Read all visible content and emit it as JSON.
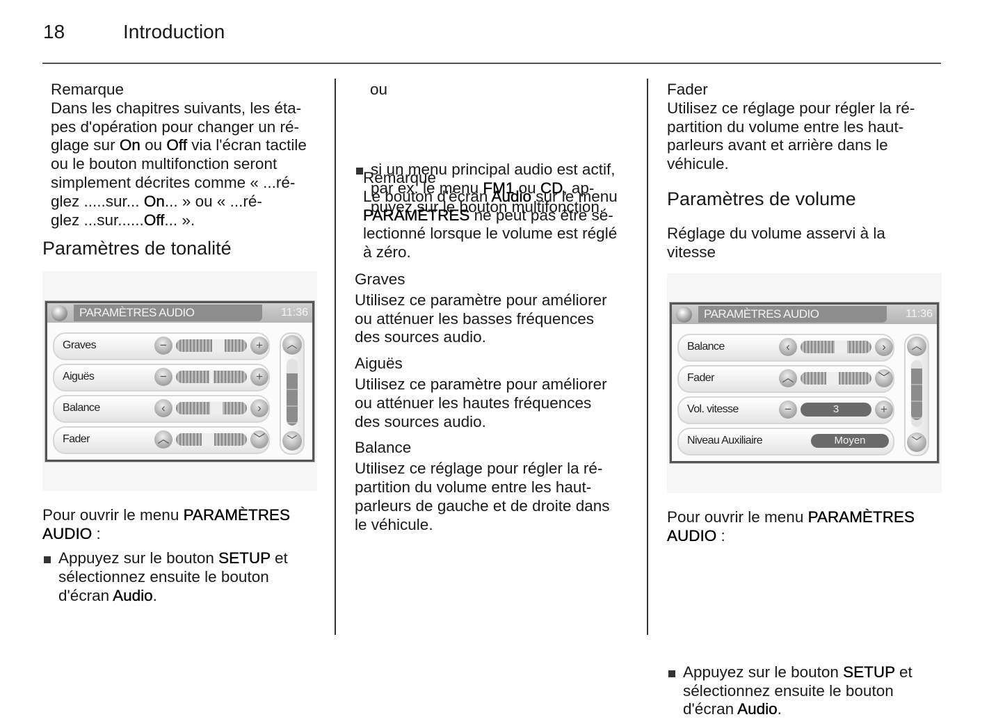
{
  "header": {
    "page_number": "18",
    "chapter_title": "Introduction"
  },
  "col1": {
    "note_title": "Remarque",
    "note_lines": [
      "Dans les chapitres suivants, les éta-",
      "pes d'opération pour changer un ré-",
      "glage sur {On} ou {Off} via l'écran tactile",
      "ou le bouton multifonction seront",
      "simplement décrites comme « ...ré-",
      "glez .....sur... {On}... » ou « ...ré-",
      "glez ...sur......{Off}... »."
    ],
    "section_title": "Paramètres de tonalité",
    "open_menu_lines": [
      "Pour ouvrir le menu {PARAMÈTRES}",
      "{AUDIO} :"
    ],
    "bullet_lines": [
      "Appuyez sur le bouton {SETUP} et",
      "sélectionnez ensuite le bouton",
      "d'écran {Audio}."
    ]
  },
  "col2": {
    "or_text": "ou",
    "bullet_lines": [
      "si un menu principal audio est actif,",
      "par ex. le menu {FM1} ou {CD}, ap-",
      "puyez sur le bouton multifonction."
    ],
    "note_title": "Remarque",
    "note_lines": [
      "Le bouton d'écran {Audio} sur le menu",
      "{PARAMÈTRES} ne peut pas être sé-",
      "lectionné lorsque le volume est réglé",
      "à zéro."
    ],
    "sections": [
      {
        "title": "Graves",
        "lines": [
          "Utilisez ce paramètre pour améliorer",
          "ou atténuer les basses fréquences",
          "des sources audio."
        ]
      },
      {
        "title": "Aiguës",
        "lines": [
          "Utilisez ce paramètre pour améliorer",
          "ou atténuer les hautes fréquences",
          "des sources audio."
        ]
      },
      {
        "title": "Balance",
        "lines": [
          "Utilisez ce réglage pour régler la ré-",
          "partition du volume entre les haut-",
          "parleurs de gauche et de droite dans",
          "le véhicule."
        ]
      }
    ]
  },
  "col3": {
    "fader_title": "Fader",
    "fader_lines": [
      "Utilisez ce réglage pour régler la ré-",
      "partition du volume entre les haut-",
      "parleurs avant et arrière dans le",
      "véhicule."
    ],
    "section_title": "Paramètres de volume",
    "subsection_lines": [
      "Réglage du volume asservi à la",
      "vitesse"
    ],
    "open_menu_lines": [
      "Pour ouvrir le menu {PARAMÈTRES}",
      "{AUDIO} :"
    ],
    "bullet_lines": [
      "Appuyez sur le bouton {SETUP} et",
      "sélectionnez ensuite le bouton",
      "d'écran {Audio}."
    ]
  },
  "screen1": {
    "title": "PARAMÈTRES AUDIO",
    "clock": "11:36",
    "rows": [
      {
        "label": "Graves",
        "type": "slider",
        "left_icon": "minus-icon",
        "right_icon": "plus-icon",
        "left_glyph": "−",
        "right_glyph": "+",
        "value": 0.6
      },
      {
        "label": "Aiguës",
        "type": "slider",
        "left_icon": "minus-icon",
        "right_icon": "plus-icon",
        "left_glyph": "−",
        "right_glyph": "+",
        "value": 0.5
      },
      {
        "label": "Balance",
        "type": "slider",
        "left_icon": "chevron-left-icon",
        "right_icon": "chevron-right-icon",
        "left_glyph": "‹",
        "right_glyph": "›",
        "value": 0.57
      },
      {
        "label": "Fader",
        "type": "slider",
        "left_icon": "chevron-up-icon",
        "right_icon": "chevron-down-icon",
        "left_glyph": "︿",
        "right_glyph": "﹀",
        "value": 0.45
      }
    ],
    "scroll_position": 0.2
  },
  "screen2": {
    "title": "PARAMÈTRES AUDIO",
    "clock": "11:36",
    "rows": [
      {
        "label": "Balance",
        "type": "slider",
        "left_icon": "chevron-left-icon",
        "right_icon": "chevron-right-icon",
        "left_glyph": "‹",
        "right_glyph": "›",
        "value": 0.57
      },
      {
        "label": "Fader",
        "type": "slider",
        "left_icon": "chevron-up-icon",
        "right_icon": "chevron-down-icon",
        "left_glyph": "︿",
        "right_glyph": "﹀",
        "value": 0.45
      },
      {
        "label": "Vol. vitesse",
        "type": "value",
        "left_icon": "minus-icon",
        "right_icon": "plus-icon",
        "left_glyph": "−",
        "right_glyph": "+",
        "display": "3"
      },
      {
        "label": "Niveau Auxiliaire",
        "type": "option",
        "display": "Moyen"
      }
    ],
    "scroll_position": 0.8
  }
}
